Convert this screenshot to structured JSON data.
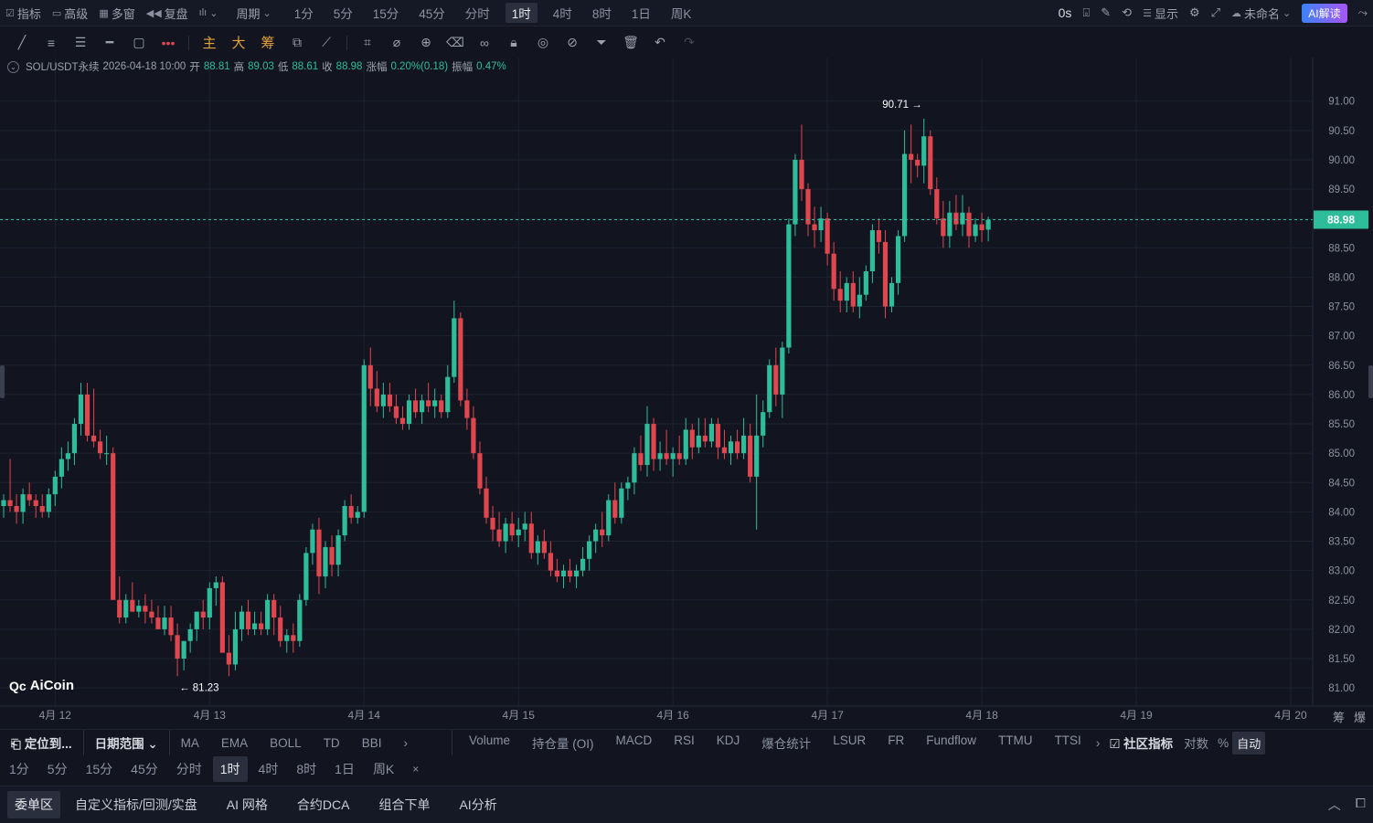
{
  "topbar": {
    "indicators_label": "指标",
    "advanced_label": "高级",
    "multiwindow_label": "多窗",
    "replay_label": "复盘",
    "period_label": "周期",
    "periods": [
      "1分",
      "5分",
      "15分",
      "45分",
      "分时",
      "1时",
      "4时",
      "8时",
      "1日",
      "周K"
    ],
    "active_period": "1时",
    "latency": "0s",
    "display_label": "显示",
    "unnamed_label": "未命名",
    "ai_label": "AI解读"
  },
  "toolbar": {
    "main_label": "主",
    "big_label": "大",
    "chips_label": "筹"
  },
  "ohlc": {
    "symbol": "SOL/USDT永续",
    "datetime": "2026-04-18 10:00",
    "open_label": "开",
    "open": "88.81",
    "high_label": "高",
    "high": "89.03",
    "low_label": "低",
    "low": "88.61",
    "close_label": "收",
    "close": "88.98",
    "change_label": "涨幅",
    "change": "0.20%(0.18)",
    "amp_label": "振幅",
    "amp": "0.47%"
  },
  "chart_data": {
    "type": "candlestick",
    "symbol": "SOL/USDT永续",
    "interval": "1时",
    "ylim": [
      80.8,
      91.4
    ],
    "yticks": [
      "91.00",
      "90.50",
      "90.00",
      "89.50",
      "89.00",
      "88.50",
      "88.00",
      "87.50",
      "87.00",
      "86.50",
      "86.00",
      "85.50",
      "85.00",
      "84.50",
      "84.00",
      "83.50",
      "83.00",
      "82.50",
      "82.00",
      "81.50",
      "81.00"
    ],
    "xticks": [
      "4月 12",
      "4月 13",
      "4月 14",
      "4月 15",
      "4月 16",
      "4月 17",
      "4月 18",
      "4月 19",
      "4月 20"
    ],
    "last_price": "88.98",
    "max_label": "90.71",
    "min_label": "81.23",
    "up_color": "#2ebd9b",
    "down_color": "#e0464e",
    "candles": [
      [
        84.1,
        84.3,
        83.9,
        84.2
      ],
      [
        84.2,
        84.9,
        84.0,
        84.1
      ],
      [
        84.1,
        84.3,
        83.8,
        84.0
      ],
      [
        84.0,
        84.4,
        83.8,
        84.3
      ],
      [
        84.3,
        84.5,
        84.1,
        84.2
      ],
      [
        84.2,
        84.3,
        83.9,
        84.1
      ],
      [
        84.1,
        84.3,
        83.9,
        84.0
      ],
      [
        84.0,
        84.4,
        83.9,
        84.3
      ],
      [
        84.3,
        84.7,
        84.1,
        84.6
      ],
      [
        84.6,
        85.1,
        84.4,
        84.9
      ],
      [
        84.9,
        85.2,
        84.7,
        85.0
      ],
      [
        85.0,
        85.6,
        84.8,
        85.5
      ],
      [
        85.5,
        86.2,
        85.3,
        86.0
      ],
      [
        86.0,
        86.2,
        85.2,
        85.3
      ],
      [
        85.3,
        86.1,
        85.1,
        85.2
      ],
      [
        85.2,
        85.4,
        84.9,
        85.0
      ],
      [
        85.0,
        85.3,
        84.8,
        85.0
      ],
      [
        85.0,
        85.1,
        82.5,
        82.5
      ],
      [
        82.5,
        82.9,
        82.1,
        82.2
      ],
      [
        82.2,
        82.6,
        82.1,
        82.5
      ],
      [
        82.5,
        82.8,
        82.3,
        82.3
      ],
      [
        82.3,
        82.5,
        82.2,
        82.4
      ],
      [
        82.4,
        82.6,
        82.1,
        82.3
      ],
      [
        82.3,
        82.5,
        82.1,
        82.2
      ],
      [
        82.2,
        82.4,
        82.0,
        82.0
      ],
      [
        82.0,
        82.4,
        81.9,
        82.2
      ],
      [
        82.2,
        82.4,
        81.8,
        81.9
      ],
      [
        81.9,
        82.1,
        81.2,
        81.5
      ],
      [
        81.5,
        81.8,
        81.3,
        81.8
      ],
      [
        81.8,
        82.1,
        81.6,
        82.0
      ],
      [
        82.0,
        82.3,
        81.8,
        82.3
      ],
      [
        82.3,
        82.5,
        82.0,
        82.2
      ],
      [
        82.2,
        82.8,
        82.0,
        82.7
      ],
      [
        82.7,
        82.9,
        82.4,
        82.8
      ],
      [
        82.8,
        82.9,
        81.6,
        81.6
      ],
      [
        81.6,
        81.9,
        81.2,
        81.4
      ],
      [
        81.4,
        82.3,
        81.3,
        82.0
      ],
      [
        82.0,
        82.4,
        81.8,
        82.3
      ],
      [
        82.3,
        82.5,
        81.9,
        82.0
      ],
      [
        82.0,
        82.3,
        81.9,
        82.1
      ],
      [
        82.1,
        82.3,
        81.9,
        82.0
      ],
      [
        82.0,
        82.6,
        81.9,
        82.5
      ],
      [
        82.5,
        82.6,
        81.9,
        82.2
      ],
      [
        82.2,
        82.4,
        81.7,
        81.8
      ],
      [
        81.8,
        82.0,
        81.6,
        81.9
      ],
      [
        81.9,
        82.1,
        81.6,
        81.8
      ],
      [
        81.8,
        82.6,
        81.7,
        82.5
      ],
      [
        82.5,
        83.4,
        82.4,
        83.3
      ],
      [
        83.3,
        83.8,
        83.1,
        83.7
      ],
      [
        83.7,
        83.9,
        82.6,
        82.9
      ],
      [
        82.9,
        83.5,
        82.7,
        83.4
      ],
      [
        83.4,
        83.6,
        82.9,
        83.1
      ],
      [
        83.1,
        83.7,
        82.9,
        83.6
      ],
      [
        83.6,
        84.2,
        83.5,
        84.1
      ],
      [
        84.1,
        84.3,
        83.8,
        83.9
      ],
      [
        83.9,
        84.1,
        83.8,
        84.0
      ],
      [
        84.0,
        86.6,
        83.9,
        86.5
      ],
      [
        86.5,
        86.8,
        85.8,
        86.1
      ],
      [
        86.1,
        86.4,
        85.7,
        85.8
      ],
      [
        85.8,
        86.2,
        85.6,
        86.0
      ],
      [
        86.0,
        86.2,
        85.7,
        85.8
      ],
      [
        85.8,
        86.0,
        85.5,
        85.6
      ],
      [
        85.6,
        85.8,
        85.4,
        85.5
      ],
      [
        85.5,
        86.0,
        85.4,
        85.9
      ],
      [
        85.9,
        86.1,
        85.6,
        85.7
      ],
      [
        85.7,
        86.0,
        85.5,
        85.9
      ],
      [
        85.9,
        86.2,
        85.7,
        85.8
      ],
      [
        85.8,
        86.1,
        85.6,
        85.9
      ],
      [
        85.9,
        86.0,
        85.6,
        85.7
      ],
      [
        85.7,
        86.5,
        85.6,
        86.3
      ],
      [
        86.3,
        87.6,
        86.2,
        87.3
      ],
      [
        87.3,
        87.4,
        85.8,
        85.9
      ],
      [
        85.9,
        86.1,
        85.4,
        85.6
      ],
      [
        85.6,
        85.8,
        84.9,
        85.0
      ],
      [
        85.0,
        85.2,
        84.3,
        84.4
      ],
      [
        84.4,
        84.6,
        83.8,
        83.9
      ],
      [
        83.9,
        84.1,
        83.5,
        83.7
      ],
      [
        83.7,
        84.0,
        83.4,
        83.5
      ],
      [
        83.5,
        83.9,
        83.3,
        83.8
      ],
      [
        83.8,
        84.0,
        83.5,
        83.6
      ],
      [
        83.6,
        83.9,
        83.4,
        83.7
      ],
      [
        83.7,
        84.0,
        83.5,
        83.8
      ],
      [
        83.8,
        84.0,
        83.2,
        83.3
      ],
      [
        83.3,
        83.6,
        83.1,
        83.5
      ],
      [
        83.5,
        83.7,
        83.2,
        83.3
      ],
      [
        83.3,
        83.5,
        82.9,
        83.0
      ],
      [
        83.0,
        83.2,
        82.8,
        82.9
      ],
      [
        82.9,
        83.1,
        82.7,
        83.0
      ],
      [
        83.0,
        83.2,
        82.8,
        82.9
      ],
      [
        82.9,
        83.1,
        82.7,
        83.0
      ],
      [
        83.0,
        83.4,
        82.9,
        83.2
      ],
      [
        83.2,
        83.6,
        83.0,
        83.5
      ],
      [
        83.5,
        83.8,
        83.3,
        83.7
      ],
      [
        83.7,
        84.0,
        83.4,
        83.6
      ],
      [
        83.6,
        84.3,
        83.5,
        84.2
      ],
      [
        84.2,
        84.5,
        83.8,
        83.9
      ],
      [
        83.9,
        84.5,
        83.8,
        84.4
      ],
      [
        84.4,
        84.6,
        84.2,
        84.5
      ],
      [
        84.5,
        85.1,
        84.3,
        85.0
      ],
      [
        85.0,
        85.3,
        84.7,
        84.8
      ],
      [
        84.8,
        85.8,
        84.6,
        85.5
      ],
      [
        85.5,
        85.6,
        84.7,
        84.9
      ],
      [
        84.9,
        85.2,
        84.7,
        85.0
      ],
      [
        85.0,
        85.4,
        84.8,
        84.9
      ],
      [
        84.9,
        85.1,
        84.6,
        85.0
      ],
      [
        85.0,
        85.3,
        84.8,
        84.9
      ],
      [
        84.9,
        85.6,
        84.8,
        85.4
      ],
      [
        85.4,
        85.5,
        84.9,
        85.1
      ],
      [
        85.1,
        85.6,
        85.0,
        85.3
      ],
      [
        85.3,
        85.6,
        85.1,
        85.2
      ],
      [
        85.2,
        85.6,
        85.1,
        85.5
      ],
      [
        85.5,
        85.6,
        84.9,
        85.1
      ],
      [
        85.1,
        85.4,
        84.9,
        85.0
      ],
      [
        85.0,
        85.3,
        84.8,
        85.2
      ],
      [
        85.2,
        85.4,
        84.9,
        85.0
      ],
      [
        85.0,
        85.6,
        84.9,
        85.3
      ],
      [
        85.3,
        85.5,
        84.5,
        84.6
      ],
      [
        84.6,
        86.0,
        83.7,
        85.3
      ],
      [
        85.3,
        85.9,
        85.1,
        85.7
      ],
      [
        85.7,
        86.6,
        85.6,
        86.5
      ],
      [
        86.5,
        86.8,
        85.8,
        86.0
      ],
      [
        86.0,
        86.9,
        85.6,
        86.8
      ],
      [
        86.8,
        89.0,
        86.7,
        88.9
      ],
      [
        88.9,
        90.1,
        88.7,
        90.0
      ],
      [
        90.0,
        90.6,
        89.3,
        89.5
      ],
      [
        89.5,
        89.6,
        88.7,
        88.9
      ],
      [
        88.9,
        89.2,
        88.5,
        88.8
      ],
      [
        88.8,
        89.2,
        88.6,
        89.0
      ],
      [
        89.0,
        89.1,
        88.2,
        88.4
      ],
      [
        88.4,
        88.6,
        87.6,
        87.8
      ],
      [
        87.8,
        88.1,
        87.4,
        87.6
      ],
      [
        87.6,
        88.0,
        87.4,
        87.9
      ],
      [
        87.9,
        88.1,
        87.4,
        87.5
      ],
      [
        87.5,
        88.0,
        87.3,
        87.7
      ],
      [
        87.7,
        88.2,
        87.6,
        88.1
      ],
      [
        88.1,
        88.9,
        87.9,
        88.8
      ],
      [
        88.8,
        89.0,
        88.4,
        88.6
      ],
      [
        88.6,
        88.8,
        87.3,
        87.5
      ],
      [
        87.5,
        88.0,
        87.4,
        87.9
      ],
      [
        87.9,
        88.8,
        87.7,
        88.7
      ],
      [
        88.7,
        90.5,
        88.6,
        90.1
      ],
      [
        90.1,
        90.6,
        89.6,
        90.0
      ],
      [
        90.0,
        90.1,
        89.7,
        89.9
      ],
      [
        89.9,
        90.7,
        89.6,
        90.4
      ],
      [
        90.4,
        90.5,
        89.4,
        89.5
      ],
      [
        89.5,
        89.7,
        88.9,
        89.0
      ],
      [
        89.0,
        89.3,
        88.5,
        88.7
      ],
      [
        88.7,
        89.3,
        88.5,
        89.1
      ],
      [
        89.1,
        89.4,
        88.8,
        88.9
      ],
      [
        88.9,
        89.4,
        88.7,
        89.1
      ],
      [
        89.1,
        89.2,
        88.5,
        88.7
      ],
      [
        88.7,
        89.0,
        88.6,
        88.9
      ],
      [
        88.9,
        89.1,
        88.6,
        88.8
      ],
      [
        88.81,
        89.03,
        88.61,
        88.98
      ]
    ]
  },
  "axis_right": {
    "tag1": "筹",
    "tag2": "爆"
  },
  "watermark": "AiCoin",
  "indbar": {
    "locate_label": "定位到...",
    "daterange_label": "日期范围",
    "main_indicators": [
      "MA",
      "EMA",
      "BOLL",
      "TD",
      "BBI"
    ],
    "sub_indicators": [
      "Volume",
      "持仓量 (OI)",
      "MACD",
      "RSI",
      "KDJ",
      "爆仓统计",
      "LSUR",
      "FR",
      "Fundflow",
      "TTMU",
      "TTSI"
    ],
    "community_label": "社区指标",
    "log_label": "对数",
    "percent_label": "%",
    "auto_label": "自动"
  },
  "perbar": {
    "periods": [
      "1分",
      "5分",
      "15分",
      "45分",
      "分时",
      "1时",
      "4时",
      "8时",
      "1日",
      "周K"
    ],
    "active": "1时",
    "close_x": "×"
  },
  "bottombar": {
    "tabs": [
      "委单区",
      "自定义指标/回测/实盘",
      "AI 网格",
      "合约DCA",
      "组合下单",
      "AI分析"
    ],
    "active": "委单区"
  }
}
